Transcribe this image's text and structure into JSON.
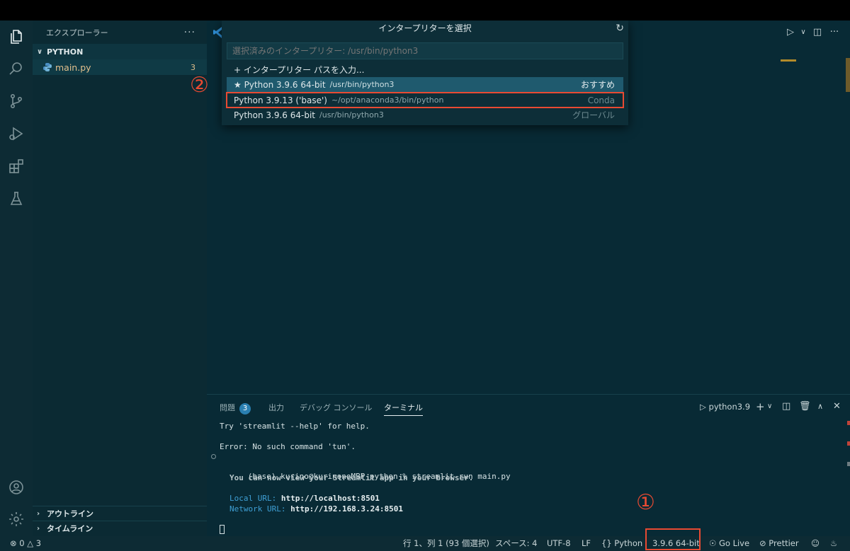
{
  "sidebar": {
    "title": "エクスプローラー",
    "more": "···",
    "folder": "PYTHON",
    "file": {
      "name": "main.py",
      "problems": "3"
    },
    "outline": "アウトライン",
    "timeline": "タイムライン"
  },
  "quickpick": {
    "title": "インタープリターを選択",
    "placeholder": "選択済みのインタープリター: /usr/bin/python3",
    "enter_path": "+ インタープリター パスを入力...",
    "items": [
      {
        "label": "★ Python 3.9.6 64-bit",
        "path": "/usr/bin/python3",
        "tag": "おすすめ"
      },
      {
        "label": "Python 3.9.13 ('base')",
        "path": "~/opt/anaconda3/bin/python",
        "tag": "Conda"
      },
      {
        "label": "Python 3.9.6 64-bit",
        "path": "/usr/bin/python3",
        "tag": "グローバル"
      }
    ]
  },
  "panel": {
    "tabs": {
      "problems": "問題",
      "problems_count": "3",
      "output": "出力",
      "debug": "デバッグ コンソール",
      "terminal": "ターミナル"
    },
    "terminal_name": "python3.9",
    "lines": {
      "l1": "Try 'streamlit --help' for help.",
      "l2": "Error: No such command 'tun'.",
      "l3": "(base) kurino@kurinonoMBP python % streamlit run main.py",
      "l4": "You can now view your Streamlit app in your browser.",
      "local_label": "Local URL: ",
      "local_url": "http://localhost:8501",
      "net_label": "Network URL: ",
      "net_url": "http://192.168.3.24:8501"
    }
  },
  "statusbar": {
    "errors": "0",
    "warnings": "3",
    "position": "行 1、列 1 (93 個選択)",
    "spaces": "スペース: 4",
    "encoding": "UTF-8",
    "eol": "LF",
    "language": "Python",
    "interpreter": "3.9.6 64-bit",
    "golive": "Go Live",
    "prettier": "Prettier"
  },
  "annotations": {
    "one": "①",
    "two": "②"
  },
  "colors": {
    "highlight": "#e84a32",
    "accent": "#2a7fb0",
    "selection": "#1f5a6e"
  }
}
